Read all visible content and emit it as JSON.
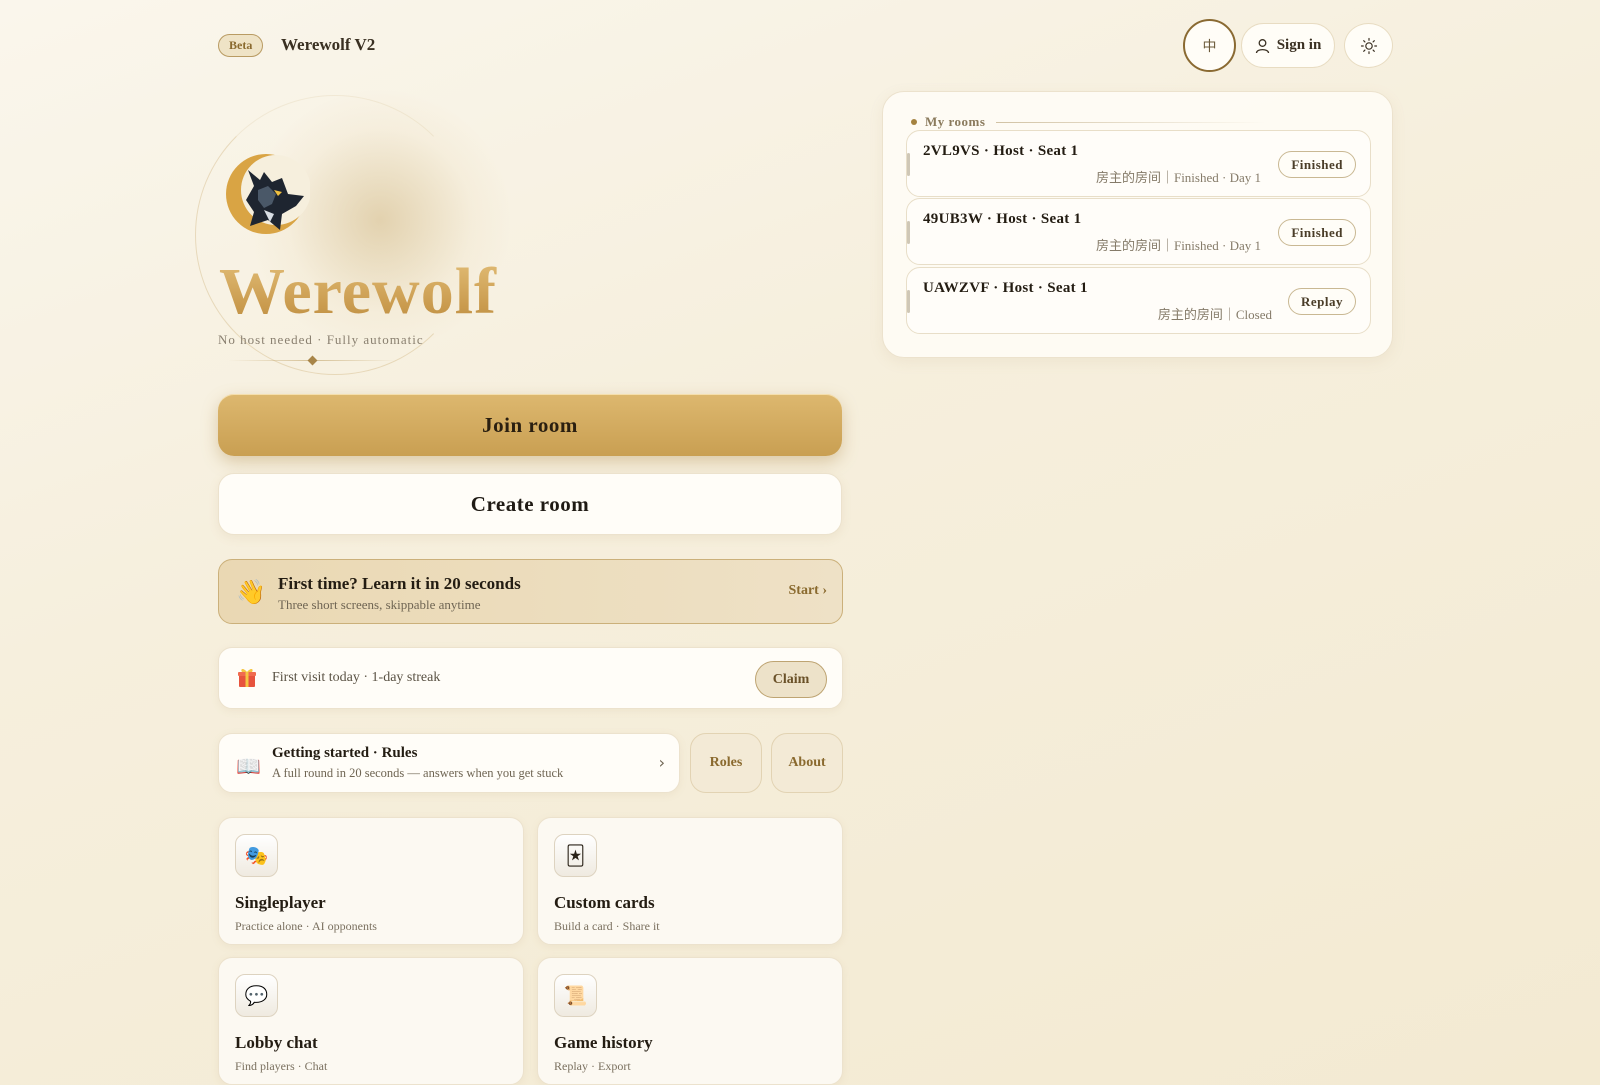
{
  "header": {
    "beta_label": "Beta",
    "app_title": "Werewolf V2",
    "lang_label": "中",
    "signin_label": "Sign in"
  },
  "hero": {
    "title": "Werewolf",
    "tagline": "No host needed · Fully automatic"
  },
  "actions": {
    "join_label": "Join room",
    "create_label": "Create room"
  },
  "tutorial": {
    "title": "First time? Learn it in 20 seconds",
    "subtitle": "Three short screens, skippable anytime",
    "start_label": "Start ›"
  },
  "streak": {
    "text": "First visit today · 1-day streak",
    "claim_label": "Claim"
  },
  "rules": {
    "title": "Getting started · Rules",
    "subtitle": "A full round in 20 seconds — answers when you get stuck",
    "roles_label": "Roles",
    "about_label": "About"
  },
  "features": [
    {
      "title": "Singleplayer",
      "subtitle": "Practice alone · AI opponents",
      "icon": "theater-masks-icon"
    },
    {
      "title": "Custom cards",
      "subtitle": "Build a card · Share it",
      "icon": "card-icon"
    },
    {
      "title": "Lobby chat",
      "subtitle": "Find players · Chat",
      "icon": "speech-bubble-icon"
    },
    {
      "title": "Game history",
      "subtitle": "Replay · Export",
      "icon": "scroll-icon"
    }
  ],
  "rooms": {
    "heading": "My rooms",
    "items": [
      {
        "title": "2VL9VS · Host · Seat 1",
        "meta": "房主的房间｜Finished · Day 1",
        "action": "Finished"
      },
      {
        "title": "49UB3W · Host · Seat 1",
        "meta": "房主的房间｜Finished · Day 1",
        "action": "Finished"
      },
      {
        "title": "UAWZVF · Host · Seat 1",
        "meta": "房主的房间｜Closed",
        "action": "Replay"
      }
    ]
  },
  "colors": {
    "accent_gold": "#c99f52",
    "background": "#f6efdd",
    "text_dark": "#231c12"
  }
}
